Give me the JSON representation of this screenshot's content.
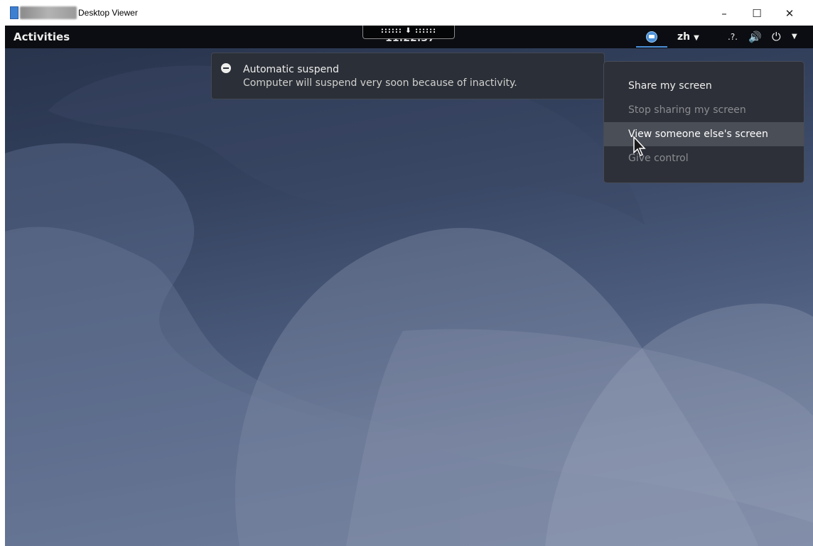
{
  "window": {
    "title": "Desktop Viewer",
    "controls": {
      "minimize": "–",
      "maximize": "☐",
      "close": "✕"
    }
  },
  "topbar": {
    "activities": "Activities",
    "clock": "11:22:37",
    "remote_toolbar": ":::::: ⬇ ::::::",
    "tray": {
      "screen_share_icon": "screen-share-icon",
      "language": "zh",
      "language_arrow": "▼",
      "accessibility": ".?.",
      "volume": "🔊",
      "power": "⏻",
      "power_arrow": "▼"
    }
  },
  "notification": {
    "title": "Automatic suspend",
    "body": "Computer will suspend very soon because of inactivity."
  },
  "screen_share_menu": {
    "items": [
      {
        "label": "Share my screen",
        "state": "enabled"
      },
      {
        "label": "Stop sharing my screen",
        "state": "disabled"
      },
      {
        "label": "View someone else's screen",
        "state": "hover"
      },
      {
        "label": "Give control",
        "state": "disabled"
      }
    ]
  },
  "colors": {
    "topbar_bg": "#0b0d12",
    "accent_blue": "#4a90d9",
    "menu_bg": "#2d3038",
    "menu_hover": "#4a4e57",
    "wallpaper_dark": "#27324a",
    "wallpaper_light": "#7d8aa6"
  }
}
